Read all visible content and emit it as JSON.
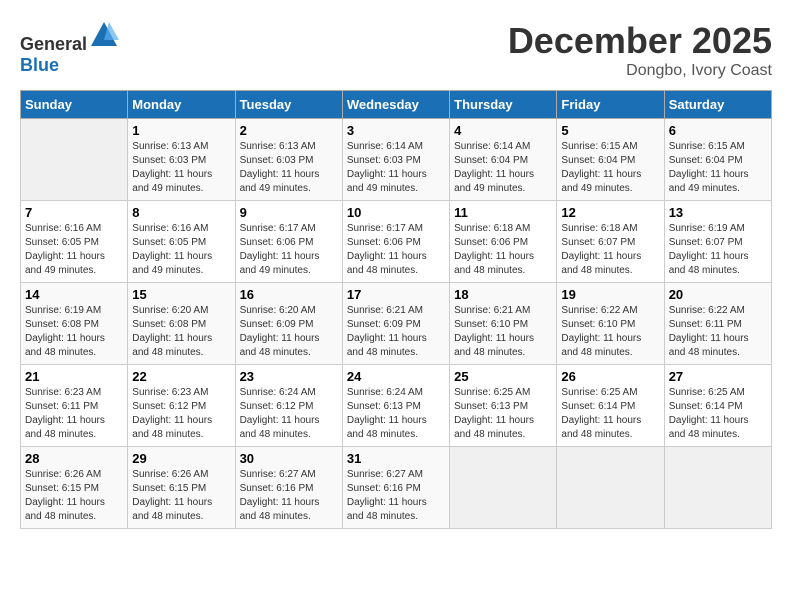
{
  "header": {
    "logo_general": "General",
    "logo_blue": "Blue",
    "month": "December 2025",
    "location": "Dongbo, Ivory Coast"
  },
  "days_of_week": [
    "Sunday",
    "Monday",
    "Tuesday",
    "Wednesday",
    "Thursday",
    "Friday",
    "Saturday"
  ],
  "weeks": [
    [
      {
        "day": "",
        "sunrise": "",
        "sunset": "",
        "daylight": "",
        "empty": true
      },
      {
        "day": "1",
        "sunrise": "Sunrise: 6:13 AM",
        "sunset": "Sunset: 6:03 PM",
        "daylight": "Daylight: 11 hours and 49 minutes.",
        "empty": false
      },
      {
        "day": "2",
        "sunrise": "Sunrise: 6:13 AM",
        "sunset": "Sunset: 6:03 PM",
        "daylight": "Daylight: 11 hours and 49 minutes.",
        "empty": false
      },
      {
        "day": "3",
        "sunrise": "Sunrise: 6:14 AM",
        "sunset": "Sunset: 6:03 PM",
        "daylight": "Daylight: 11 hours and 49 minutes.",
        "empty": false
      },
      {
        "day": "4",
        "sunrise": "Sunrise: 6:14 AM",
        "sunset": "Sunset: 6:04 PM",
        "daylight": "Daylight: 11 hours and 49 minutes.",
        "empty": false
      },
      {
        "day": "5",
        "sunrise": "Sunrise: 6:15 AM",
        "sunset": "Sunset: 6:04 PM",
        "daylight": "Daylight: 11 hours and 49 minutes.",
        "empty": false
      },
      {
        "day": "6",
        "sunrise": "Sunrise: 6:15 AM",
        "sunset": "Sunset: 6:04 PM",
        "daylight": "Daylight: 11 hours and 49 minutes.",
        "empty": false
      }
    ],
    [
      {
        "day": "7",
        "sunrise": "Sunrise: 6:16 AM",
        "sunset": "Sunset: 6:05 PM",
        "daylight": "Daylight: 11 hours and 49 minutes.",
        "empty": false
      },
      {
        "day": "8",
        "sunrise": "Sunrise: 6:16 AM",
        "sunset": "Sunset: 6:05 PM",
        "daylight": "Daylight: 11 hours and 49 minutes.",
        "empty": false
      },
      {
        "day": "9",
        "sunrise": "Sunrise: 6:17 AM",
        "sunset": "Sunset: 6:06 PM",
        "daylight": "Daylight: 11 hours and 49 minutes.",
        "empty": false
      },
      {
        "day": "10",
        "sunrise": "Sunrise: 6:17 AM",
        "sunset": "Sunset: 6:06 PM",
        "daylight": "Daylight: 11 hours and 48 minutes.",
        "empty": false
      },
      {
        "day": "11",
        "sunrise": "Sunrise: 6:18 AM",
        "sunset": "Sunset: 6:06 PM",
        "daylight": "Daylight: 11 hours and 48 minutes.",
        "empty": false
      },
      {
        "day": "12",
        "sunrise": "Sunrise: 6:18 AM",
        "sunset": "Sunset: 6:07 PM",
        "daylight": "Daylight: 11 hours and 48 minutes.",
        "empty": false
      },
      {
        "day": "13",
        "sunrise": "Sunrise: 6:19 AM",
        "sunset": "Sunset: 6:07 PM",
        "daylight": "Daylight: 11 hours and 48 minutes.",
        "empty": false
      }
    ],
    [
      {
        "day": "14",
        "sunrise": "Sunrise: 6:19 AM",
        "sunset": "Sunset: 6:08 PM",
        "daylight": "Daylight: 11 hours and 48 minutes.",
        "empty": false
      },
      {
        "day": "15",
        "sunrise": "Sunrise: 6:20 AM",
        "sunset": "Sunset: 6:08 PM",
        "daylight": "Daylight: 11 hours and 48 minutes.",
        "empty": false
      },
      {
        "day": "16",
        "sunrise": "Sunrise: 6:20 AM",
        "sunset": "Sunset: 6:09 PM",
        "daylight": "Daylight: 11 hours and 48 minutes.",
        "empty": false
      },
      {
        "day": "17",
        "sunrise": "Sunrise: 6:21 AM",
        "sunset": "Sunset: 6:09 PM",
        "daylight": "Daylight: 11 hours and 48 minutes.",
        "empty": false
      },
      {
        "day": "18",
        "sunrise": "Sunrise: 6:21 AM",
        "sunset": "Sunset: 6:10 PM",
        "daylight": "Daylight: 11 hours and 48 minutes.",
        "empty": false
      },
      {
        "day": "19",
        "sunrise": "Sunrise: 6:22 AM",
        "sunset": "Sunset: 6:10 PM",
        "daylight": "Daylight: 11 hours and 48 minutes.",
        "empty": false
      },
      {
        "day": "20",
        "sunrise": "Sunrise: 6:22 AM",
        "sunset": "Sunset: 6:11 PM",
        "daylight": "Daylight: 11 hours and 48 minutes.",
        "empty": false
      }
    ],
    [
      {
        "day": "21",
        "sunrise": "Sunrise: 6:23 AM",
        "sunset": "Sunset: 6:11 PM",
        "daylight": "Daylight: 11 hours and 48 minutes.",
        "empty": false
      },
      {
        "day": "22",
        "sunrise": "Sunrise: 6:23 AM",
        "sunset": "Sunset: 6:12 PM",
        "daylight": "Daylight: 11 hours and 48 minutes.",
        "empty": false
      },
      {
        "day": "23",
        "sunrise": "Sunrise: 6:24 AM",
        "sunset": "Sunset: 6:12 PM",
        "daylight": "Daylight: 11 hours and 48 minutes.",
        "empty": false
      },
      {
        "day": "24",
        "sunrise": "Sunrise: 6:24 AM",
        "sunset": "Sunset: 6:13 PM",
        "daylight": "Daylight: 11 hours and 48 minutes.",
        "empty": false
      },
      {
        "day": "25",
        "sunrise": "Sunrise: 6:25 AM",
        "sunset": "Sunset: 6:13 PM",
        "daylight": "Daylight: 11 hours and 48 minutes.",
        "empty": false
      },
      {
        "day": "26",
        "sunrise": "Sunrise: 6:25 AM",
        "sunset": "Sunset: 6:14 PM",
        "daylight": "Daylight: 11 hours and 48 minutes.",
        "empty": false
      },
      {
        "day": "27",
        "sunrise": "Sunrise: 6:25 AM",
        "sunset": "Sunset: 6:14 PM",
        "daylight": "Daylight: 11 hours and 48 minutes.",
        "empty": false
      }
    ],
    [
      {
        "day": "28",
        "sunrise": "Sunrise: 6:26 AM",
        "sunset": "Sunset: 6:15 PM",
        "daylight": "Daylight: 11 hours and 48 minutes.",
        "empty": false
      },
      {
        "day": "29",
        "sunrise": "Sunrise: 6:26 AM",
        "sunset": "Sunset: 6:15 PM",
        "daylight": "Daylight: 11 hours and 48 minutes.",
        "empty": false
      },
      {
        "day": "30",
        "sunrise": "Sunrise: 6:27 AM",
        "sunset": "Sunset: 6:16 PM",
        "daylight": "Daylight: 11 hours and 48 minutes.",
        "empty": false
      },
      {
        "day": "31",
        "sunrise": "Sunrise: 6:27 AM",
        "sunset": "Sunset: 6:16 PM",
        "daylight": "Daylight: 11 hours and 48 minutes.",
        "empty": false
      },
      {
        "day": "",
        "sunrise": "",
        "sunset": "",
        "daylight": "",
        "empty": true
      },
      {
        "day": "",
        "sunrise": "",
        "sunset": "",
        "daylight": "",
        "empty": true
      },
      {
        "day": "",
        "sunrise": "",
        "sunset": "",
        "daylight": "",
        "empty": true
      }
    ]
  ]
}
